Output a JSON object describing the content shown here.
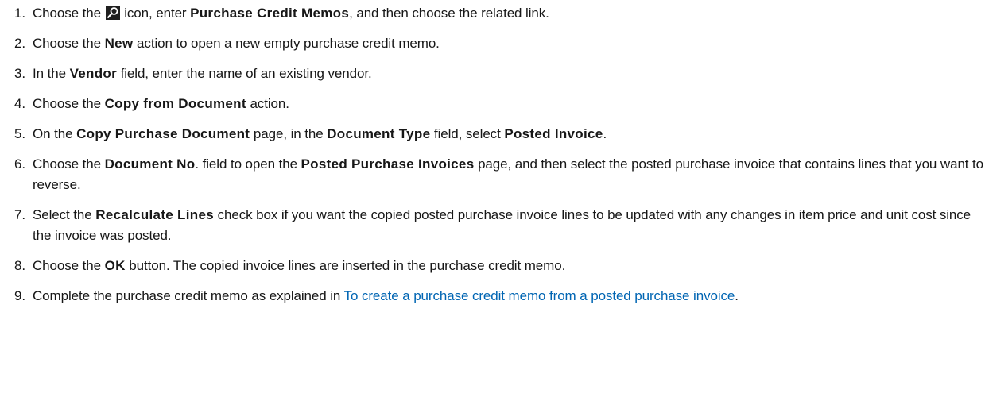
{
  "steps": [
    {
      "num": "1.",
      "parts": [
        {
          "t": "Choose the "
        },
        {
          "icon": "search-icon"
        },
        {
          "t": " icon, enter "
        },
        {
          "b": "Purchase Credit Memos"
        },
        {
          "t": ", and then choose the related link."
        }
      ]
    },
    {
      "num": "2.",
      "parts": [
        {
          "t": "Choose the "
        },
        {
          "b": "New"
        },
        {
          "t": " action to open a new empty purchase credit memo."
        }
      ]
    },
    {
      "num": "3.",
      "parts": [
        {
          "t": "In the "
        },
        {
          "b": "Vendor"
        },
        {
          "t": " field, enter the name of an existing vendor."
        }
      ]
    },
    {
      "num": "4.",
      "parts": [
        {
          "t": "Choose the "
        },
        {
          "b": "Copy from Document"
        },
        {
          "t": " action."
        }
      ]
    },
    {
      "num": "5.",
      "parts": [
        {
          "t": "On the "
        },
        {
          "b": "Copy Purchase Document"
        },
        {
          "t": " page, in the "
        },
        {
          "b": "Document Type"
        },
        {
          "t": " field, select "
        },
        {
          "b": "Posted Invoice"
        },
        {
          "t": "."
        }
      ]
    },
    {
      "num": "6.",
      "parts": [
        {
          "t": "Choose the "
        },
        {
          "b": "Document No"
        },
        {
          "t": ". field to open the "
        },
        {
          "b": "Posted Purchase Invoices"
        },
        {
          "t": " page, and then select the posted purchase invoice that contains lines that you want to reverse."
        }
      ]
    },
    {
      "num": "7.",
      "parts": [
        {
          "t": "Select the "
        },
        {
          "b": "Recalculate Lines"
        },
        {
          "t": " check box if you want the copied posted purchase invoice lines to be updated with any changes in item price and unit cost since the invoice was posted."
        }
      ]
    },
    {
      "num": "8.",
      "parts": [
        {
          "t": "Choose the "
        },
        {
          "b": "OK"
        },
        {
          "t": " button. The copied invoice lines are inserted in the purchase credit memo."
        }
      ]
    },
    {
      "num": "9.",
      "parts": [
        {
          "t": "Complete the purchase credit memo as explained in "
        },
        {
          "link": "To create a purchase credit memo from a posted purchase invoice"
        },
        {
          "t": "."
        }
      ]
    }
  ],
  "colors": {
    "text": "#171717",
    "link": "#0065b3",
    "icon_bg": "#1f1f1f",
    "icon_fg": "#ffffff"
  }
}
